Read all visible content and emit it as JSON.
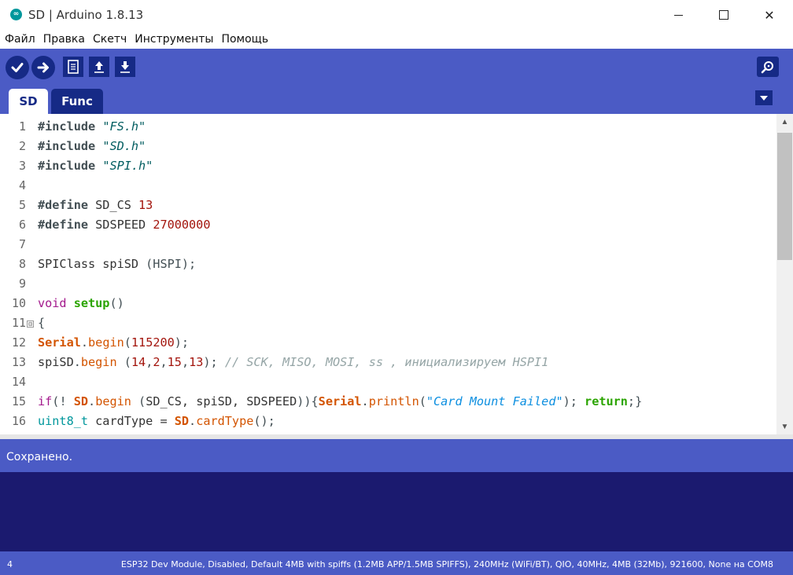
{
  "window": {
    "title": "SD | Arduino 1.8.13",
    "logo_glyph": "∞",
    "close_glyph": "✕"
  },
  "menu": [
    "Файл",
    "Правка",
    "Скетч",
    "Инструменты",
    "Помощь"
  ],
  "toolbar": {
    "buttons": [
      "verify-icon",
      "upload-icon",
      "new-icon",
      "open-icon",
      "save-icon"
    ],
    "serial_monitor": "serial-monitor-icon"
  },
  "tabs": [
    {
      "label": "SD",
      "active": true
    },
    {
      "label": "Func",
      "active": false
    }
  ],
  "editor": {
    "lines": [
      {
        "n": "1",
        "tokens": [
          [
            "pp",
            "#include"
          ],
          [
            "",
            " "
          ],
          [
            "str",
            "\"FS.h\""
          ]
        ]
      },
      {
        "n": "2",
        "tokens": [
          [
            "pp",
            "#include"
          ],
          [
            "",
            " "
          ],
          [
            "str",
            "\"SD.h\""
          ]
        ]
      },
      {
        "n": "3",
        "tokens": [
          [
            "pp",
            "#include"
          ],
          [
            "",
            " "
          ],
          [
            "str",
            "\"SPI.h\""
          ]
        ]
      },
      {
        "n": "4",
        "tokens": []
      },
      {
        "n": "5",
        "tokens": [
          [
            "pp",
            "#define"
          ],
          [
            "",
            " SD_CS "
          ],
          [
            "num",
            "13"
          ]
        ]
      },
      {
        "n": "6",
        "tokens": [
          [
            "pp",
            "#define"
          ],
          [
            "",
            " SDSPEED "
          ],
          [
            "num",
            "27000000"
          ]
        ]
      },
      {
        "n": "7",
        "tokens": []
      },
      {
        "n": "8",
        "tokens": [
          [
            "",
            "SPIClass spiSD "
          ],
          [
            "pun",
            "(HSPI);"
          ]
        ]
      },
      {
        "n": "9",
        "tokens": []
      },
      {
        "n": "10",
        "tokens": [
          [
            "kw",
            "void"
          ],
          [
            "",
            " "
          ],
          [
            "fn",
            "setup"
          ],
          [
            "pun",
            "()"
          ]
        ]
      },
      {
        "n": "11",
        "fold": "⊟",
        "tokens": [
          [
            "pun",
            "{"
          ]
        ]
      },
      {
        "n": "12",
        "tokens": [
          [
            "serial",
            "Serial"
          ],
          [
            "pun",
            "."
          ],
          [
            "method",
            "begin"
          ],
          [
            "pun",
            "("
          ],
          [
            "num",
            "115200"
          ],
          [
            "pun",
            ");"
          ]
        ]
      },
      {
        "n": "13",
        "tokens": [
          [
            "",
            "spiSD"
          ],
          [
            "pun",
            "."
          ],
          [
            "method",
            "begin"
          ],
          [
            "pun",
            " ("
          ],
          [
            "num",
            "14"
          ],
          [
            "pun",
            ","
          ],
          [
            "num",
            "2"
          ],
          [
            "pun",
            ","
          ],
          [
            "num",
            "15"
          ],
          [
            "pun",
            ","
          ],
          [
            "num",
            "13"
          ],
          [
            "pun",
            "); "
          ],
          [
            "cmt",
            "// SCK, MISO, MOSI, ss , инициализируем HSPI1"
          ]
        ]
      },
      {
        "n": "14",
        "tokens": []
      },
      {
        "n": "15",
        "tokens": [
          [
            "kw",
            "if"
          ],
          [
            "pun",
            "(! "
          ],
          [
            "serial",
            "SD"
          ],
          [
            "pun",
            "."
          ],
          [
            "method",
            "begin"
          ],
          [
            "pun",
            " ("
          ],
          [
            "",
            "SD_CS, spiSD, SDSPEED"
          ],
          [
            "pun",
            ")){"
          ],
          [
            "serial",
            "Serial"
          ],
          [
            "pun",
            "."
          ],
          [
            "method",
            "println"
          ],
          [
            "pun",
            "("
          ],
          [
            "strb",
            "\"Card Mount Failed\""
          ],
          [
            "pun",
            "); "
          ],
          [
            "ret",
            "return"
          ],
          [
            "pun",
            ";}"
          ]
        ]
      },
      {
        "n": "16",
        "tokens": [
          [
            "type",
            "uint8_t"
          ],
          [
            "",
            " cardType = "
          ],
          [
            "serial",
            "SD"
          ],
          [
            "pun",
            "."
          ],
          [
            "method",
            "cardType"
          ],
          [
            "pun",
            "();"
          ]
        ]
      }
    ]
  },
  "status": {
    "message": "Сохранено."
  },
  "footer": {
    "line_number": "4",
    "board": "ESP32 Dev Module, Disabled, Default 4MB with spiffs (1.2MB APP/1.5MB SPIFFS), 240MHz (WiFi/BT), QIO, 40MHz, 4MB (32Mb), 921600, None на COM8"
  }
}
